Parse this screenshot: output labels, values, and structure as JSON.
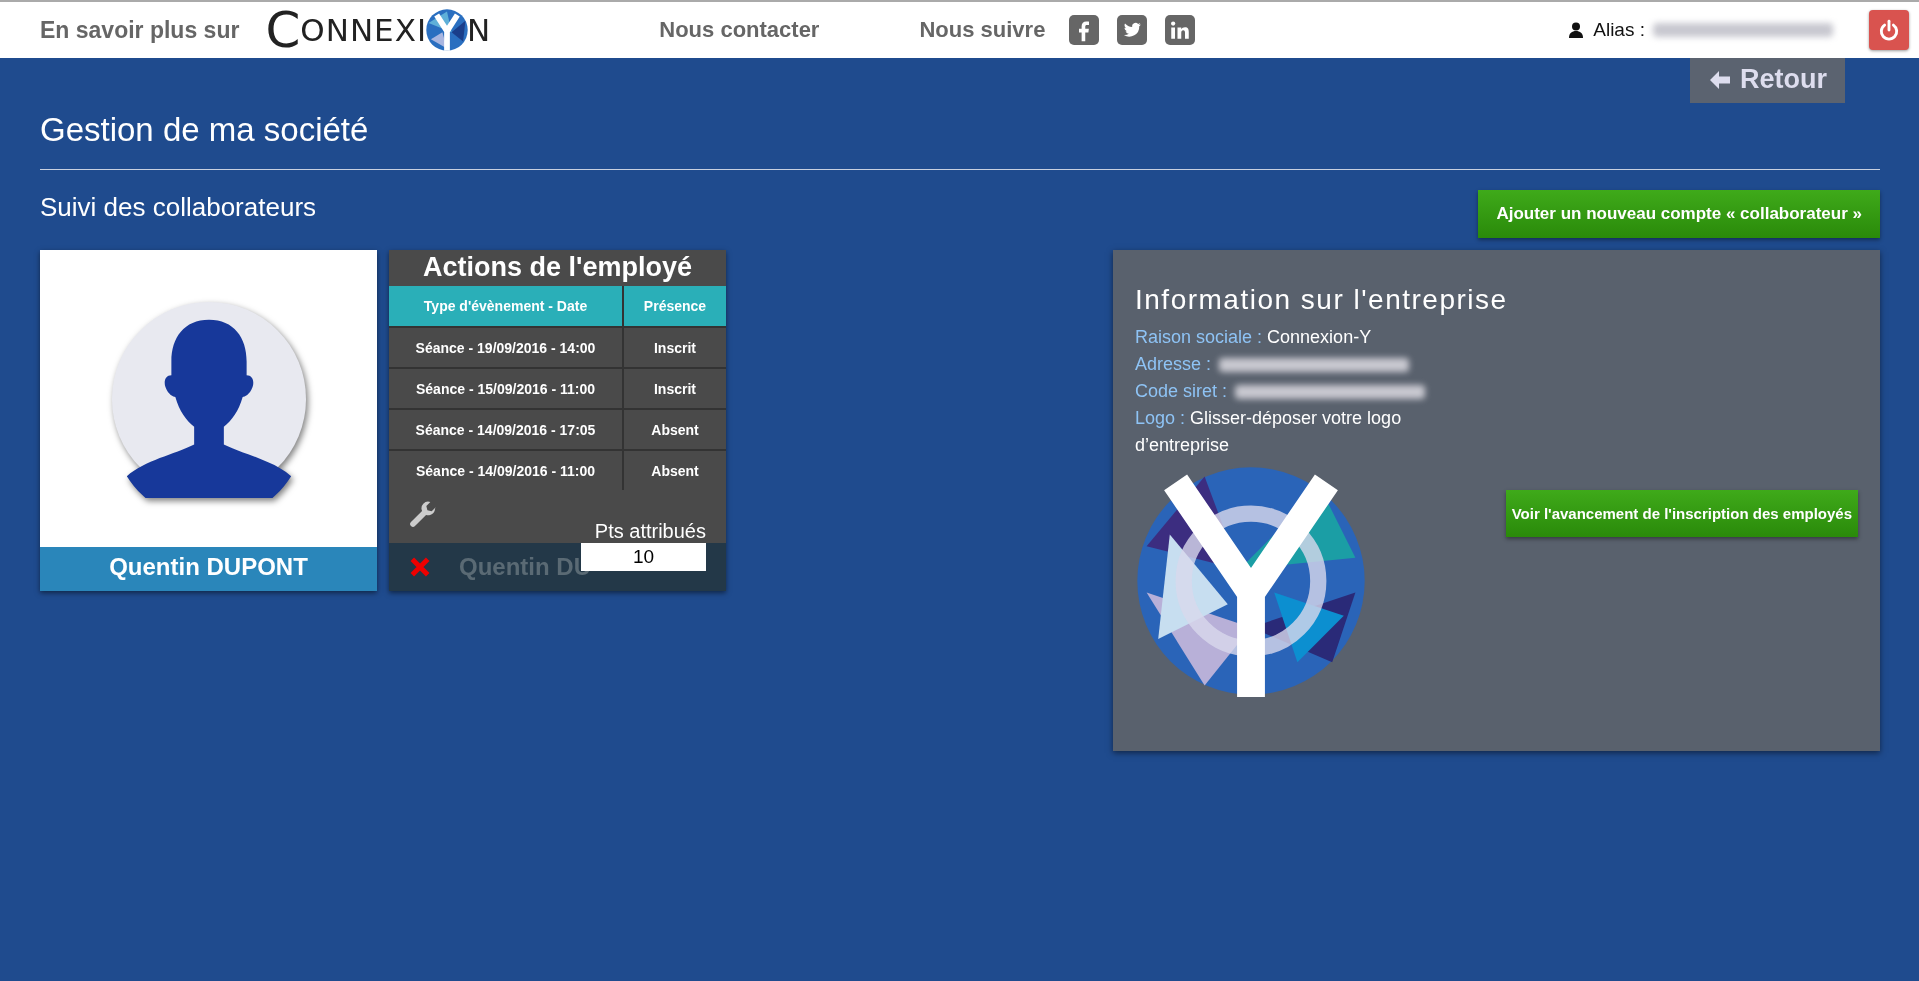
{
  "topbar": {
    "about": "En savoir plus sur",
    "logo": {
      "lead": "C",
      "middle": "ONNEXI",
      "tail": "N"
    },
    "contact": "Nous contacter",
    "follow": "Nous suivre",
    "alias_label": "Alias :"
  },
  "back_button": {
    "label": "Retour"
  },
  "page_title": "Gestion de ma société",
  "section_title": "Suivi des collaborateurs",
  "add_button": "Ajouter un nouveau compte « collaborateur »",
  "employee_card": {
    "name": "Quentin DUPONT"
  },
  "actions_card": {
    "title": "Actions de l'employé",
    "columns": [
      "Type d'évènement - Date",
      "Présence"
    ],
    "rows": [
      [
        "Séance - 19/09/2016 - 14:00",
        "Inscrit"
      ],
      [
        "Séance - 15/09/2016 - 11:00",
        "Inscrit"
      ],
      [
        "Séance - 14/09/2016 - 17:05",
        "Absent"
      ],
      [
        "Séance - 14/09/2016 - 11:00",
        "Absent"
      ]
    ],
    "points_label": "Pts attribués",
    "points_value": "10",
    "ghost_name": "Quentin DU"
  },
  "company": {
    "title": "Information sur l'entreprise",
    "fields": [
      {
        "label": "Raison sociale :",
        "value": "Connexion-Y",
        "blurred": false
      },
      {
        "label": "Adresse :",
        "blurred": true
      },
      {
        "label": "Code siret :",
        "blurred": true
      },
      {
        "label": "Logo :",
        "value": "Glisser-déposer votre logo d’entreprise",
        "blurred": false
      }
    ],
    "progress_button": "Voir l'avancement de l'inscription des employés"
  }
}
